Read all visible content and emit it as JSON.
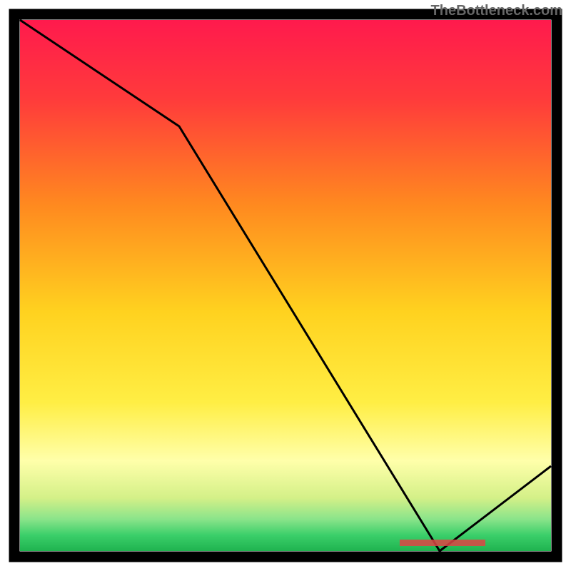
{
  "attribution": "TheBottleneck.com",
  "chart_data": {
    "type": "line",
    "x": [
      0,
      0.3,
      0.79,
      1.0
    ],
    "values": [
      1.0,
      0.8,
      0.0,
      0.16
    ],
    "title": "",
    "xlabel": "",
    "ylabel": "",
    "xlim": [
      0,
      1
    ],
    "ylim": [
      0,
      1
    ],
    "annotations": [
      {
        "text": "",
        "x": 0.8,
        "y": 0.01
      }
    ],
    "background": "vertical-gradient-red-orange-yellow-yellowgreen-green",
    "background_bands_approx": [
      {
        "y0": 1.0,
        "y1": 0.24,
        "color_top": "#ff1a4d",
        "color_bottom": "#ffdd33"
      },
      {
        "y0": 0.24,
        "y1": 0.1,
        "color_top": "#ffee44",
        "color_bottom": "#ffffaa"
      },
      {
        "y0": 0.1,
        "y1": 0.04,
        "color_top": "#d4f088",
        "color_bottom": "#7edc7e"
      },
      {
        "y0": 0.04,
        "y1": 0.0,
        "color_top": "#3bcf6a",
        "color_bottom": "#1fb34f"
      }
    ]
  }
}
